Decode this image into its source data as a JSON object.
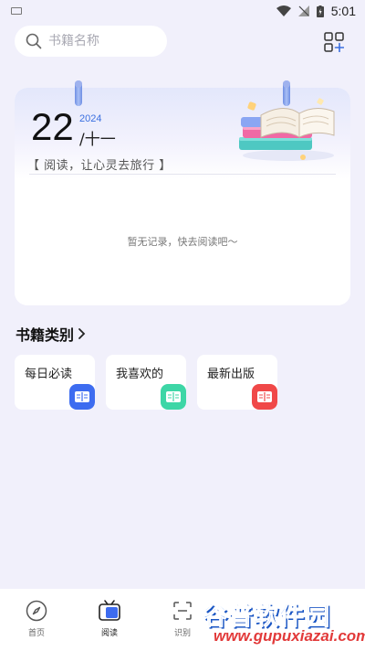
{
  "status_bar": {
    "time": "5:01"
  },
  "search": {
    "placeholder": "书籍名称"
  },
  "calendar": {
    "day": "22",
    "year": "2024",
    "lunar": "/十一",
    "slogan": "【 阅读，让心灵去旅行 】",
    "empty_text": "暂无记录，快去阅读吧～"
  },
  "categories": {
    "title": "书籍类别",
    "items": [
      {
        "label": "每日必读",
        "color": "#3d6cf0"
      },
      {
        "label": "我喜欢的",
        "color": "#3dd6a6"
      },
      {
        "label": "最新出版",
        "color": "#f04848"
      }
    ]
  },
  "nav": {
    "items": [
      {
        "label": "首页",
        "icon": "compass-icon"
      },
      {
        "label": "阅读",
        "icon": "tv-book-icon",
        "active": true
      },
      {
        "label": "识别",
        "icon": "scan-icon"
      }
    ]
  },
  "watermark": {
    "main": "谷普软件园",
    "url": "www.gupuxiazai.com"
  },
  "colors": {
    "accent": "#3a6fe0",
    "background": "#f1f0fb"
  }
}
